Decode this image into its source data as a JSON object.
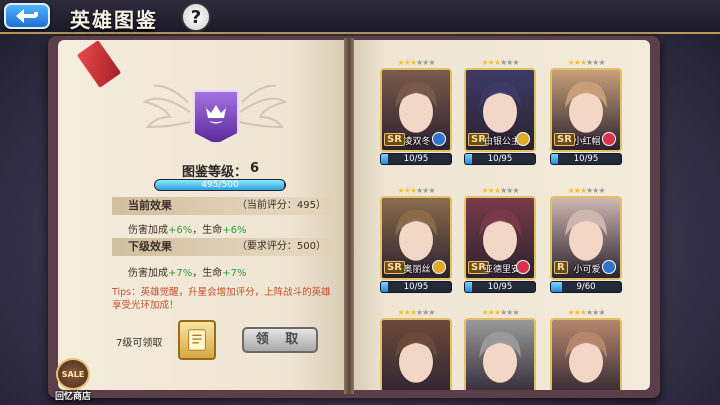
{
  "header": {
    "title": "英雄图鉴",
    "help_label": "?"
  },
  "left_page": {
    "level_label": "图鉴等级：",
    "level_value": "6",
    "exp_text": "495/500",
    "exp_fraction": 0.99,
    "current_effect": {
      "label": "当前效果",
      "score": "（当前评分：495）",
      "line_a": "伤害加成",
      "line_a_value": "+6%",
      "line_sep": "，生命",
      "line_b_value": "+6%"
    },
    "next_effect": {
      "label": "下级效果",
      "score": "（要求评分：500）",
      "line_a": "伤害加成",
      "line_a_value": "+7%",
      "line_sep": "，生命",
      "line_b_value": "+7%"
    },
    "tips": "Tips：英雄觉醒，升星会增加评分，上阵战斗的英雄享受光环加成！",
    "unlock_text": "7级可领取",
    "claim_label": "领 取"
  },
  "shop": {
    "badge": "SALE",
    "label": "回忆商店"
  },
  "heroes": [
    {
      "name": "凌双冬",
      "rank": "SR",
      "stars": 3,
      "shards": "10/95",
      "progress": 0.105,
      "elem_color": "#2f74c9",
      "bg": "#7b5a4a"
    },
    {
      "name": "白银公主",
      "rank": "SR",
      "stars": 3,
      "shards": "10/95",
      "progress": 0.105,
      "elem_color": "#e0a92b",
      "bg": "#3d3a66"
    },
    {
      "name": "小红帽",
      "rank": "SR",
      "stars": 3,
      "shards": "10/95",
      "progress": 0.105,
      "elem_color": "#d8334a",
      "bg": "#c9a07a"
    },
    {
      "name": "奥丽丝",
      "rank": "SR",
      "stars": 3,
      "shards": "10/95",
      "progress": 0.105,
      "elem_color": "#e0a92b",
      "bg": "#8b6b4b"
    },
    {
      "name": "亚德里安",
      "rank": "SR",
      "stars": 3,
      "shards": "10/95",
      "progress": 0.105,
      "elem_color": "#d8334a",
      "bg": "#7a3a4a"
    },
    {
      "name": "小可爱",
      "rank": "R",
      "stars": 3,
      "shards": "9/60",
      "progress": 0.15,
      "elem_color": "#2f74c9",
      "bg": "#cfb8b0"
    },
    {
      "name": "",
      "rank": "",
      "stars": 3,
      "shards": "",
      "progress": 0,
      "elem_color": "#e0a92b",
      "bg": "#6c4a3a"
    },
    {
      "name": "",
      "rank": "",
      "stars": 3,
      "shards": "",
      "progress": 0,
      "elem_color": "#999999",
      "bg": "#9a9a9a"
    },
    {
      "name": "",
      "rank": "",
      "stars": 3,
      "shards": "",
      "progress": 0,
      "elem_color": "#d8334a",
      "bg": "#b7876c"
    }
  ]
}
